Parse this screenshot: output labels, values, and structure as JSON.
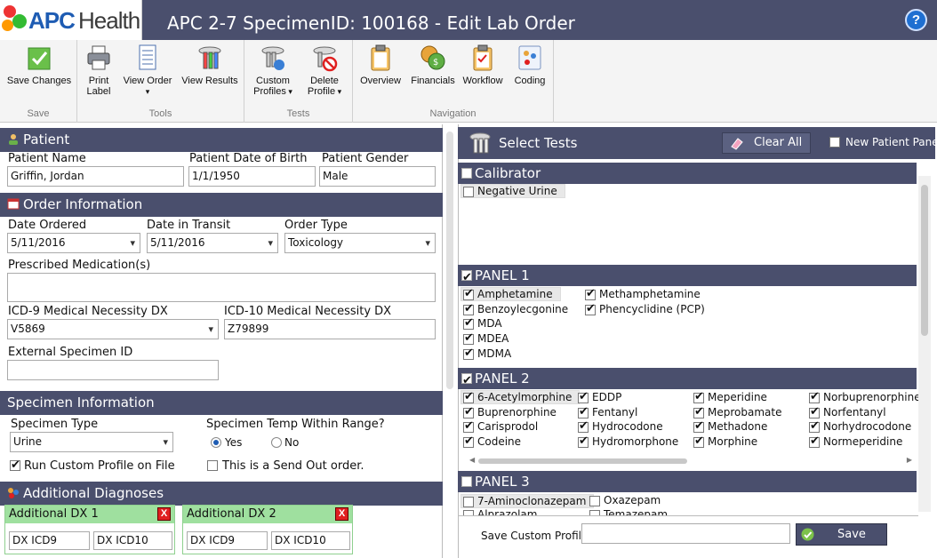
{
  "window": {
    "title": "APC 2-7 SpecimenID: 100168 - Edit Lab Order",
    "logo_a": "APC",
    "logo_b": "Health",
    "help": "?"
  },
  "ribbon": {
    "groups": {
      "save": "Save",
      "tools": "Tools",
      "tests": "Tests",
      "navigation": "Navigation"
    },
    "buttons": {
      "save_changes": "Save Changes",
      "print_label_1": "Print",
      "print_label_2": "Label",
      "view_order": "View Order",
      "view_results": "View Results",
      "custom_profiles_1": "Custom",
      "custom_profiles_2": "Profiles",
      "delete_profile_1": "Delete",
      "delete_profile_2": "Profile",
      "overview": "Overview",
      "financials": "Financials",
      "workflow": "Workflow",
      "coding": "Coding"
    }
  },
  "patient": {
    "header": "Patient",
    "name_label": "Patient Name",
    "name": "Griffin, Jordan",
    "dob_label": "Patient Date of Birth",
    "dob": "1/1/1950",
    "gender_label": "Patient Gender",
    "gender": "Male"
  },
  "order": {
    "header": "Order Information",
    "date_ordered_label": "Date Ordered",
    "date_ordered": "5/11/2016",
    "date_transit_label": "Date in Transit",
    "date_transit": "5/11/2016",
    "order_type_label": "Order Type",
    "order_type": "Toxicology",
    "medication_label": "Prescribed Medication(s)",
    "medication": "",
    "icd9_label": "ICD-9 Medical Necessity DX",
    "icd9": "V5869",
    "icd10_label": "ICD-10 Medical Necessity DX",
    "icd10": "Z79899",
    "ext_id_label": "External Specimen ID",
    "ext_id": ""
  },
  "specimen": {
    "header": "Specimen Information",
    "type_label": "Specimen Type",
    "type": "Urine",
    "temp_label": "Specimen Temp Within Range?",
    "yes": "Yes",
    "no": "No",
    "temp_selected": "Yes",
    "run_custom": "Run Custom Profile on File",
    "run_custom_checked": true,
    "send_out": "This is a Send Out order.",
    "send_out_checked": false
  },
  "diagnoses": {
    "header": "Additional Diagnoses",
    "boxes": [
      {
        "title": "Additional DX 1",
        "icd9": "DX ICD9",
        "icd10": "DX ICD10"
      },
      {
        "title": "Additional DX 2",
        "icd9": "DX ICD9",
        "icd10": "DX ICD10"
      }
    ],
    "close": "X"
  },
  "tests": {
    "header": "Select Tests",
    "clear_all": "Clear All",
    "new_patient_panel": "New Patient Panel",
    "calibrator": {
      "name": "Calibrator",
      "items": [
        "Negative Urine"
      ]
    },
    "panel1": {
      "name": "PANEL 1",
      "items": [
        "Amphetamine",
        "Benzoylecgonine",
        "MDA",
        "MDEA",
        "MDMA",
        "Methamphetamine",
        "Phencyclidine (PCP)"
      ]
    },
    "panel2": {
      "name": "PANEL 2",
      "items": [
        "6-Acetylmorphine",
        "Buprenorphine",
        "Carisprodol",
        "Codeine",
        "EDDP",
        "Fentanyl",
        "Hydrocodone",
        "Hydromorphone",
        "Meperidine",
        "Meprobamate",
        "Methadone",
        "Morphine",
        "Norbuprenorphine",
        "Norfentanyl",
        "Norhydrocodone",
        "Normeperidine"
      ]
    },
    "panel3": {
      "name": "PANEL 3",
      "items": [
        "7-Aminoclonazepam",
        "Oxazepam",
        "Alprazolam",
        "Temazepam"
      ]
    }
  },
  "footer": {
    "save_profile_label": "Save Custom Profile",
    "save_profile_value": "",
    "save": "Save"
  }
}
